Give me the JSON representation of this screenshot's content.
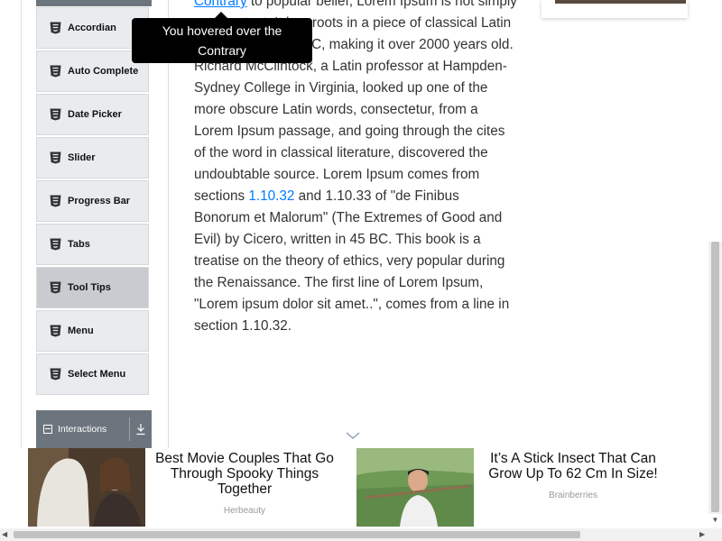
{
  "sidebar": {
    "items": [
      {
        "label": "Accordian",
        "icon": "html5-icon"
      },
      {
        "label": "Auto Complete",
        "icon": "html5-icon"
      },
      {
        "label": "Date Picker",
        "icon": "html5-icon"
      },
      {
        "label": "Slider",
        "icon": "html5-icon"
      },
      {
        "label": "Progress Bar",
        "icon": "html5-icon"
      },
      {
        "label": "Tabs",
        "icon": "html5-icon"
      },
      {
        "label": "Tool Tips",
        "icon": "html5-icon",
        "active": true
      },
      {
        "label": "Menu",
        "icon": "html5-icon"
      },
      {
        "label": "Select Menu",
        "icon": "html5-icon"
      }
    ],
    "group": {
      "label": "Interactions",
      "icon": "collapse-icon",
      "action_icon": "download-icon"
    }
  },
  "tooltip": {
    "text": "You hovered over the Contrary"
  },
  "content": {
    "link_contrary": "Contrary",
    "text_1": " to popular belief, Lorem Ipsum is not simply random text. It has roots in a piece of classical Latin literature from 45 BC, making it over 2000 years old. Richard McClintock, a Latin professor at Hampden-Sydney College in Virginia, looked up one of the more obscure Latin words, consectetur, from a Lorem Ipsum passage, and going through the cites of the word in classical literature, discovered the undoubtable source. Lorem Ipsum comes from sections ",
    "link_section": "1.10.32",
    "text_2": " and 1.10.33 of \"de Finibus Bonorum et Malorum\" (The Extremes of Good and Evil) by Cicero, written in 45 BC. This book is a treatise on the theory of ethics, very popular during the Renaissance. The first line of Lorem Ipsum, \"Lorem ipsum dolor sit amet..\", comes from a line in section 1.10.32."
  },
  "ads": [
    {
      "headline": "Best Movie Couples That Go Through Spooky Things Together",
      "source": "Herbeauty"
    },
    {
      "headline": "It’s A Stick Insect That Can Grow Up To 62 Cm In Size!",
      "source": "Brainberries"
    }
  ],
  "colors": {
    "accent": "#007bff",
    "sidebar_bg": "#e9ecef",
    "sidebar_active": "#c8cbcf",
    "group_header": "#6c757d",
    "tooltip_bg": "#000000"
  }
}
